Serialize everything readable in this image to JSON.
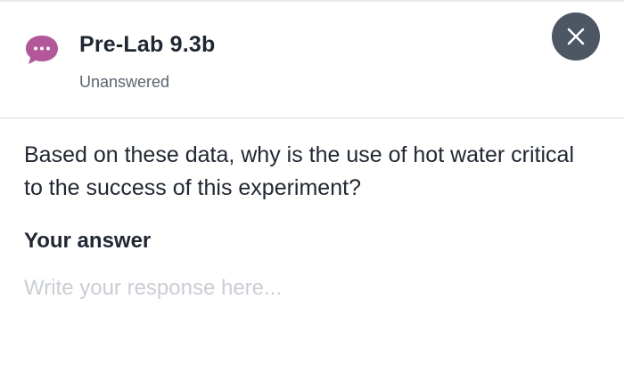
{
  "header": {
    "title": "Pre-Lab 9.3b",
    "status": "Unanswered",
    "icon": "chat-bubble-icon",
    "icon_color": "#b4579a",
    "close_icon": "close-icon",
    "close_button_color": "#4d5763"
  },
  "question": {
    "text": "Based on these data, why is the use of hot water critical to the success of this experiment?"
  },
  "answer": {
    "label": "Your answer",
    "value": "",
    "placeholder": "Write your response here..."
  }
}
